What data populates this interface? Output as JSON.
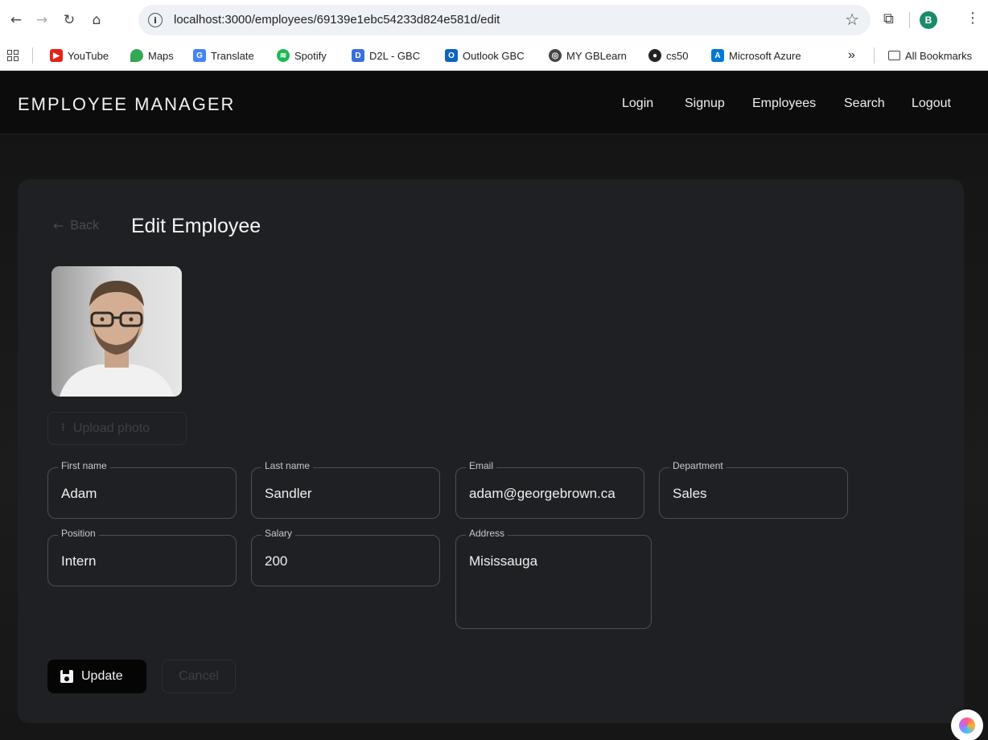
{
  "browser": {
    "url": "localhost:3000/employees/69139e1ebc54233d824e581d/edit",
    "profile_initial": "B",
    "bookmarks": [
      {
        "label": "YouTube",
        "color": "#e62117"
      },
      {
        "label": "Maps",
        "color": "#34a853"
      },
      {
        "label": "Translate",
        "color": "#4285f4"
      },
      {
        "label": "Spotify",
        "color": "#1db954"
      },
      {
        "label": "D2L - GBC",
        "color": "#3a6fd8"
      },
      {
        "label": "Outlook GBC",
        "color": "#0a66c2"
      },
      {
        "label": "MY GBLearn",
        "color": "#444444"
      },
      {
        "label": "cs50",
        "color": "#222222"
      },
      {
        "label": "Microsoft Azure",
        "color": "#0078d4"
      }
    ],
    "more_bookmarks": "»",
    "all_bookmarks": "All Bookmarks"
  },
  "app": {
    "brand": "EMPLOYEE MANAGER",
    "nav": [
      "Login",
      "Signup",
      "Employees",
      "Search",
      "Logout"
    ],
    "back_label": "Back",
    "title": "Edit Employee",
    "upload_label": "Upload photo",
    "fields": {
      "first_name": {
        "label": "First name",
        "value": "Adam"
      },
      "last_name": {
        "label": "Last name",
        "value": "Sandler"
      },
      "email": {
        "label": "Email",
        "value": "adam@georgebrown.ca"
      },
      "department": {
        "label": "Department",
        "value": "Sales"
      },
      "position": {
        "label": "Position",
        "value": "Intern"
      },
      "salary": {
        "label": "Salary",
        "value": "200"
      },
      "address": {
        "label": "Address",
        "value": "Misissauga"
      }
    },
    "update_label": "Update",
    "cancel_label": "Cancel"
  }
}
